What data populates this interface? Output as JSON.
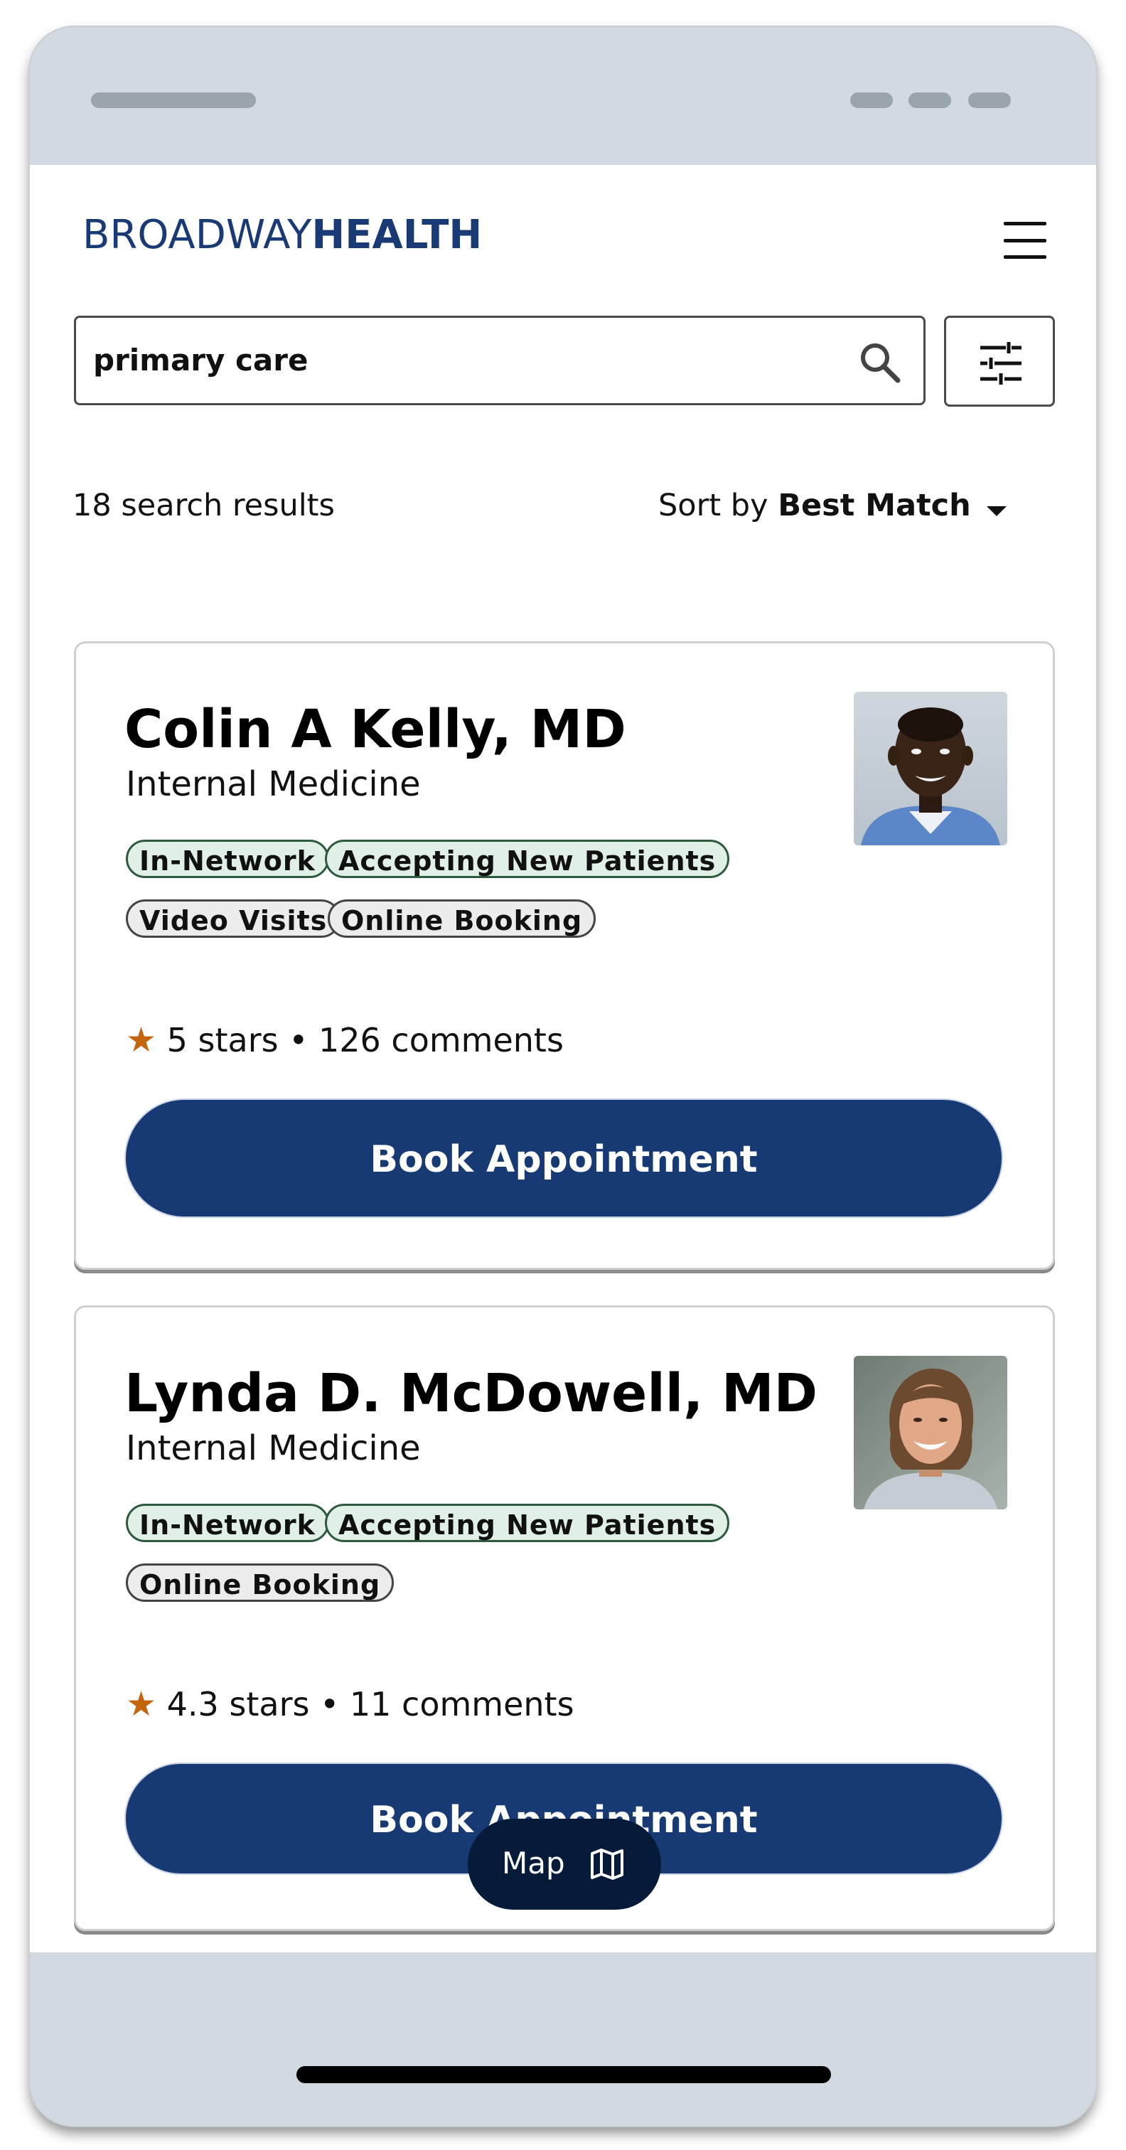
{
  "header": {
    "logo_part1": "BROADWAY",
    "logo_part2": "HEALTH"
  },
  "search": {
    "value": "primary care"
  },
  "results": {
    "count_text": "18 search results",
    "sort_prefix": "Sort by",
    "sort_value": "Best Match"
  },
  "doctors": [
    {
      "name": "Colin A Kelly, MD",
      "specialty": "Internal Medicine",
      "tags": [
        "In-Network",
        "Accepting New Patients",
        "Video Visits",
        "Online Booking"
      ],
      "rating_text": "5 stars • 126 comments",
      "button": "Book Appointment"
    },
    {
      "name": "Lynda D. McDowell, MD",
      "specialty": "Internal Medicine",
      "tags": [
        "In-Network",
        "Accepting New Patients",
        "Online Booking"
      ],
      "rating_text": "4.3 stars • 11 comments",
      "button": "Book Appointment"
    }
  ],
  "map_button": {
    "label": "Map"
  },
  "colors": {
    "brand": "#1a3a76",
    "button": "#173a74",
    "map_button": "#061b3a",
    "star": "#c4650e",
    "tag_green": "#e1f0e6"
  },
  "icons": [
    "menu-icon",
    "search-icon",
    "filter-icon",
    "caret-down-icon",
    "star-icon",
    "map-icon"
  ]
}
